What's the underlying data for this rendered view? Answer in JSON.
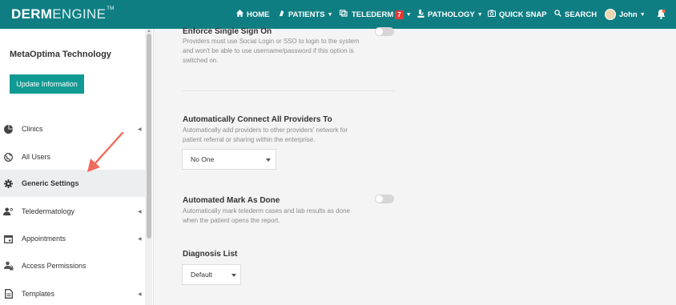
{
  "app": {
    "logo_bold": "DERM",
    "logo_light": "ENGINE",
    "logo_tm": "TM"
  },
  "nav": {
    "home": "HOME",
    "patients": "PATIENTS",
    "telederm": "TELEDERM",
    "telederm_badge": "7",
    "pathology": "PATHOLOGY",
    "quick_snap": "QUICK SNAP",
    "search": "SEARCH",
    "user": "John"
  },
  "sidebar": {
    "org_name": "MetaOptima Technology",
    "update_button": "Update Information",
    "items": [
      {
        "label": "Clinics",
        "icon": "pie-icon",
        "chevron": true
      },
      {
        "label": "All Users",
        "icon": "globe-icon",
        "chevron": false
      },
      {
        "label": "Generic Settings",
        "icon": "gear-icon",
        "chevron": false,
        "active": true
      },
      {
        "label": "Teledermatology",
        "icon": "users-icon",
        "chevron": true
      },
      {
        "label": "Appointments",
        "icon": "calendar-icon",
        "chevron": true
      },
      {
        "label": "Access Permissions",
        "icon": "lock-icon",
        "chevron": false
      },
      {
        "label": "Templates",
        "icon": "file-icon",
        "chevron": true
      }
    ]
  },
  "settings": {
    "sso": {
      "title": "Enforce Single Sign On",
      "desc": "Providers must use Social Login or SSO to login to the system and won't be able to use username/password if this option is switched on.",
      "enabled": false
    },
    "connect": {
      "title": "Automatically Connect All Providers To",
      "desc": "Automatically add providers to other providers' network for patient referral or sharing within the enterprise.",
      "selected": "No One"
    },
    "mark_done": {
      "title": "Automated Mark As Done",
      "desc": "Automatically mark telederm cases and lab results as done when the patient opens the report.",
      "enabled": false
    },
    "diagnosis": {
      "title": "Diagnosis List",
      "selected": "Default"
    }
  },
  "colors": {
    "topbar": "#0f7e83",
    "accent": "#119a94",
    "annotation_arrow": "#ef6b5b"
  }
}
